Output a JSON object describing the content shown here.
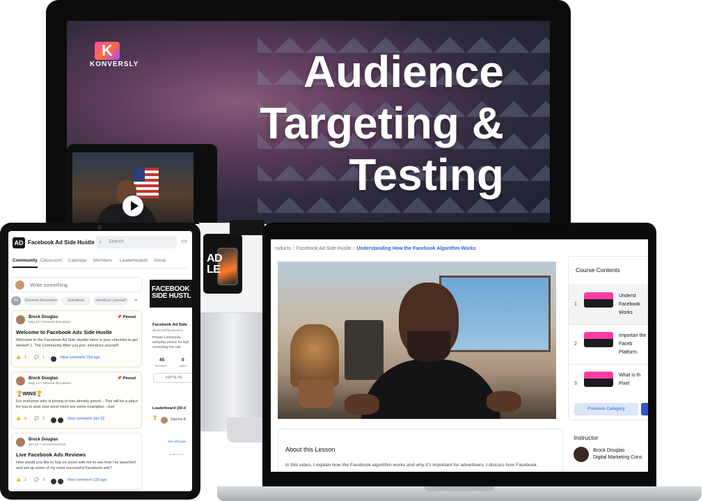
{
  "hero": {
    "brand": "KONVERSLY",
    "brand_letter": "K",
    "title_line1": "Audience",
    "title_line2": "Targeting &",
    "title_line3": "Testing"
  },
  "community": {
    "logo": "AD",
    "group_name": "Facebook Ad Side Hustle",
    "search_placeholder": "Search",
    "tabs": [
      "Community",
      "Classroom",
      "Calendar",
      "Members",
      "Leaderboards",
      "About"
    ],
    "active_tab": "Community",
    "write_placeholder": "Write something",
    "chips": [
      "All",
      "General discussion",
      "Questions",
      "Introduce yourself"
    ],
    "posts": [
      {
        "author": "Brock Douglas",
        "meta": "May 14 • General discussion",
        "pinned": "Pinned",
        "title": "Welcome to Facebook Ads Side Hustle",
        "body": "Welcome to the Facebook Ad Side Hustle! Here is your checklist to get started! 1. The Community After you join, introduce yourself",
        "likes": "7",
        "comments": "1",
        "last_comment": "New comment 15d ago"
      },
      {
        "author": "Brock Douglas",
        "meta": "May 14 • General discussion",
        "pinned": "Pinned",
        "title": "🏆WINS🏆",
        "body": "For everyone who is joining or has already joined... This will be a place for you to post your wins! Here are some examples: -Just",
        "likes": "5",
        "comments": "2",
        "last_comment": "New comment Jan 22"
      },
      {
        "author": "Brock Douglas",
        "meta": "Jan 22 • Announcements",
        "title": "Live Facebook Ads Reviews",
        "body": "How would you like to hop on zoom with me to see how I've launched and set up some of my most successful Facebook ads?",
        "likes": "2",
        "comments": "3",
        "last_comment": "New comment 12d ago"
      }
    ],
    "side": {
      "banner_line1": "FACEBOOK",
      "banner_line2": "SIDE HUSTL",
      "name": "Facebook Ad Side",
      "url": "skool.com/facebook-a",
      "desc": "Private Community everyday person ho high converting Fac Ads",
      "members_count": "45",
      "members_label": "Members",
      "online_count": "0",
      "online_label": "Online",
      "invite_label": "INVITE PE",
      "leaderboard_label": "Leaderboard (30-d",
      "leader_name": "Sienna E",
      "see_all": "See all leade",
      "powered": "powered by"
    }
  },
  "mini_phone": {
    "line1": "AD",
    "line2": "LE"
  },
  "lesson": {
    "breadcrumb_1": "roducts",
    "breadcrumb_2": "Facebook Ad Side Hustle",
    "breadcrumb_current": "Understanding How the Facebook Algorithm Works",
    "about_title": "About this Lesson",
    "about_text": "In this video, I explain how the Facebook algorithm works and why it's important for advertisers. I discuss how Facebook",
    "course_title": "Course Contents",
    "items": [
      {
        "num": "1",
        "label": "Underst Facebook Works"
      },
      {
        "num": "2",
        "label": "Importan the Faceb Platform"
      },
      {
        "num": "3",
        "label": "What is th Pixel"
      }
    ],
    "prev_label": "Previous Category",
    "instructor_title": "Instructor",
    "instructor_name": "Brock Douglas",
    "instructor_role": "Digital Marketing Cons"
  },
  "colors": {
    "accent": "#2563eb",
    "brand_pink": "#ff4fa3",
    "pin_border": "#eadfc5"
  }
}
